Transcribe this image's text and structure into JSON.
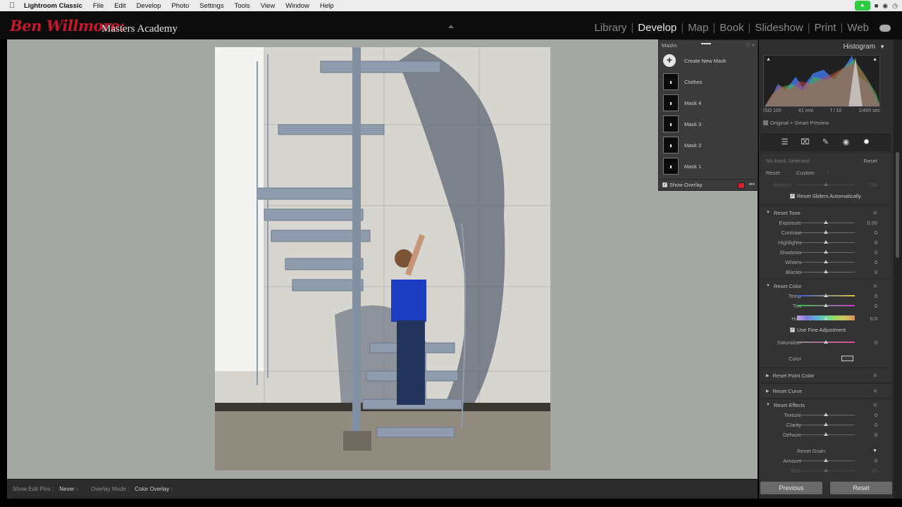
{
  "menubar": {
    "apple": "",
    "app_name": "Lightroom Classic",
    "items": [
      "File",
      "Edit",
      "Develop",
      "Photo",
      "Settings",
      "Tools",
      "View",
      "Window",
      "Help"
    ]
  },
  "identity": {
    "brand_script": "Ben Willmore:",
    "brand_text": "Masters Academy"
  },
  "modules": {
    "items": [
      "Library",
      "Develop",
      "Map",
      "Book",
      "Slideshow",
      "Print",
      "Web"
    ],
    "active": "Develop",
    "separator": "|"
  },
  "masks_panel": {
    "title": "Masks",
    "create_label": "Create New Mask",
    "masks": [
      "Clothes",
      "Mask 4",
      "Mask 3",
      "Mask 2",
      "Mask 1"
    ],
    "show_overlay_label": "Show Overlay",
    "overlay_color": "#d3212d"
  },
  "histogram": {
    "title": "Histogram",
    "iso": "ISO 100",
    "focal": "41 mm",
    "aperture": "f / 10",
    "shutter": "1/400 sec",
    "preview": "Original + Smart Preview"
  },
  "mask_settings": {
    "no_mask": "No Mask Selected",
    "reset": "Reset",
    "reset_label": "Reset",
    "preset_value": "Custom",
    "amount_label": "Amount",
    "amount_value": "100",
    "reset_sliders_label": "Reset Sliders Automatically"
  },
  "tone": {
    "title": "Reset Tone",
    "sliders": [
      {
        "label": "Exposure",
        "value": "0.00"
      },
      {
        "label": "Contrast",
        "value": "0"
      },
      {
        "label": "Highlights",
        "value": "0"
      },
      {
        "label": "Shadows",
        "value": "0"
      },
      {
        "label": "Whites",
        "value": "0"
      },
      {
        "label": "Blacks",
        "value": "0"
      }
    ]
  },
  "color": {
    "title": "Reset Color",
    "temp_label": "Temp",
    "temp_value": "0",
    "tint_label": "Tint",
    "tint_value": "0",
    "hue_label": "Hue",
    "hue_value": "0.0",
    "fine_label": "Use Fine Adjustment",
    "saturation_label": "Saturation",
    "saturation_value": "0",
    "color_label": "Color"
  },
  "collapsed": {
    "point_color": "Reset Point Color",
    "curve": "Reset Curve"
  },
  "effects": {
    "title": "Reset Effects",
    "sliders": [
      {
        "label": "Texture",
        "value": "0"
      },
      {
        "label": "Clarity",
        "value": "0"
      },
      {
        "label": "Dehaze",
        "value": "0"
      }
    ],
    "grain_title": "Reset Grain",
    "grain_amount_label": "Amount",
    "grain_amount_value": "0",
    "grain_size_label": "Size",
    "grain_size_value": "25"
  },
  "toolbar": {
    "show_pins_label": "Show Edit Pins :",
    "show_pins_value": "Never",
    "overlay_mode_label": "Overlay Mode :",
    "overlay_mode_value": "Color Overlay"
  },
  "buttons": {
    "previous": "Previous",
    "reset": "Reset"
  }
}
